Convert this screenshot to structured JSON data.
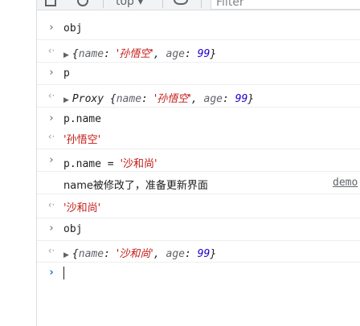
{
  "toolbar": {
    "context_label": "top ▾",
    "filter_placeholder": "Filter",
    "sidebar_icon": "sidebar-icon",
    "clear_icon": "clear-console-icon",
    "eye_icon": "eye-icon"
  },
  "console": {
    "entries": [
      {
        "kind": "input",
        "text": "obj"
      },
      {
        "kind": "output",
        "prefix": "",
        "obj": {
          "name": "'孙悟空'",
          "age": "99"
        }
      },
      {
        "kind": "input",
        "text": "p"
      },
      {
        "kind": "output",
        "prefix": "Proxy ",
        "obj": {
          "name": "'孙悟空'",
          "age": "99"
        }
      },
      {
        "kind": "input",
        "text": "p.name"
      },
      {
        "kind": "output_string",
        "text": "'孙悟空'"
      },
      {
        "kind": "input_assign",
        "lhs": "p.name",
        "op": "=",
        "rhs": "'沙和尚'"
      },
      {
        "kind": "log",
        "text": "name被修改了，准备更新界面",
        "source": "demo"
      },
      {
        "kind": "output_string",
        "text": "'沙和尚'"
      },
      {
        "kind": "input",
        "text": "obj"
      },
      {
        "kind": "output",
        "prefix": "",
        "obj": {
          "name": "'沙和尚'",
          "age": "99"
        }
      }
    ]
  },
  "labels": {
    "name_key": "name",
    "age_key": "age"
  }
}
